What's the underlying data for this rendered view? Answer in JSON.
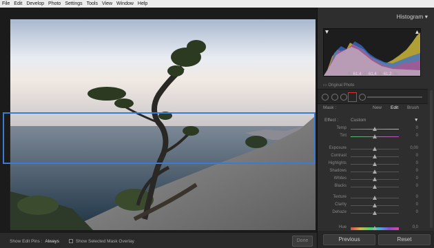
{
  "menu": [
    "File",
    "Edit",
    "Develop",
    "Photo",
    "Settings",
    "Tools",
    "View",
    "Window",
    "Help"
  ],
  "histogram": {
    "title": "Histogram",
    "r_label": "R",
    "r_value": "61,4",
    "g_label": "G",
    "g_value": "61,4",
    "b_label": "B",
    "b_value": "61,2",
    "percent": "%",
    "original_photo": "Original Photo"
  },
  "mask": {
    "label": "Mask :",
    "new": "New",
    "edit": "Edit",
    "brush": "Brush"
  },
  "effect": {
    "label": "Effect :",
    "preset": "Custom"
  },
  "sliders": [
    {
      "name": "Temp",
      "value": "0"
    },
    {
      "name": "Tint",
      "value": "0"
    },
    {
      "name": "Exposure",
      "value": "0,00"
    },
    {
      "name": "Contrast",
      "value": "0"
    },
    {
      "name": "Highlights",
      "value": "0"
    },
    {
      "name": "Shadows",
      "value": "0"
    },
    {
      "name": "Whites",
      "value": "0"
    },
    {
      "name": "Blacks",
      "value": "0"
    },
    {
      "name": "Texture",
      "value": "0"
    },
    {
      "name": "Clarity",
      "value": "0"
    },
    {
      "name": "Dehaze",
      "value": "0"
    },
    {
      "name": "Hue",
      "value": "0,0"
    }
  ],
  "bottom": {
    "show_edit_pins_label": "Show Edit Pins :",
    "show_edit_pins_value": "Always",
    "show_overlay_label": "Show Selected Mask Overlay",
    "done": "Done"
  },
  "buttons": {
    "previous": "Previous",
    "reset": "Reset"
  },
  "colors": {
    "accent_selection": "#3a7bd5",
    "tool_highlight": "#e03030"
  }
}
